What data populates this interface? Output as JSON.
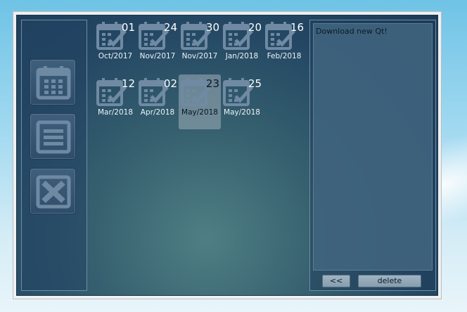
{
  "colors": {
    "canvas_dark": "#1d3a56",
    "canvas_mid": "#36606f",
    "panel_border": "#6d8ea8",
    "button_face": "#9fb4c3",
    "selected_bg": "#a0afb9"
  },
  "sidebar": {
    "buttons": [
      {
        "name": "calendar-button",
        "icon": "calendar-icon"
      },
      {
        "name": "list-button",
        "icon": "list-icon"
      },
      {
        "name": "close-button",
        "icon": "close-icon"
      }
    ]
  },
  "entries": [
    {
      "day": "01",
      "month": "Oct/2017"
    },
    {
      "day": "24",
      "month": "Nov/2017"
    },
    {
      "day": "30",
      "month": "Nov/2017"
    },
    {
      "day": "20",
      "month": "Jan/2018"
    },
    {
      "day": "16",
      "month": "Feb/2018"
    },
    {
      "day": "12",
      "month": "Mar/2018"
    },
    {
      "day": "02",
      "month": "Apr/2018"
    },
    {
      "day": "23",
      "month": "May/2018",
      "selected": true
    },
    {
      "day": "25",
      "month": "May/2018"
    }
  ],
  "detail": {
    "text": "Download new Qt!",
    "back_label": "<<",
    "delete_label": "delete"
  }
}
